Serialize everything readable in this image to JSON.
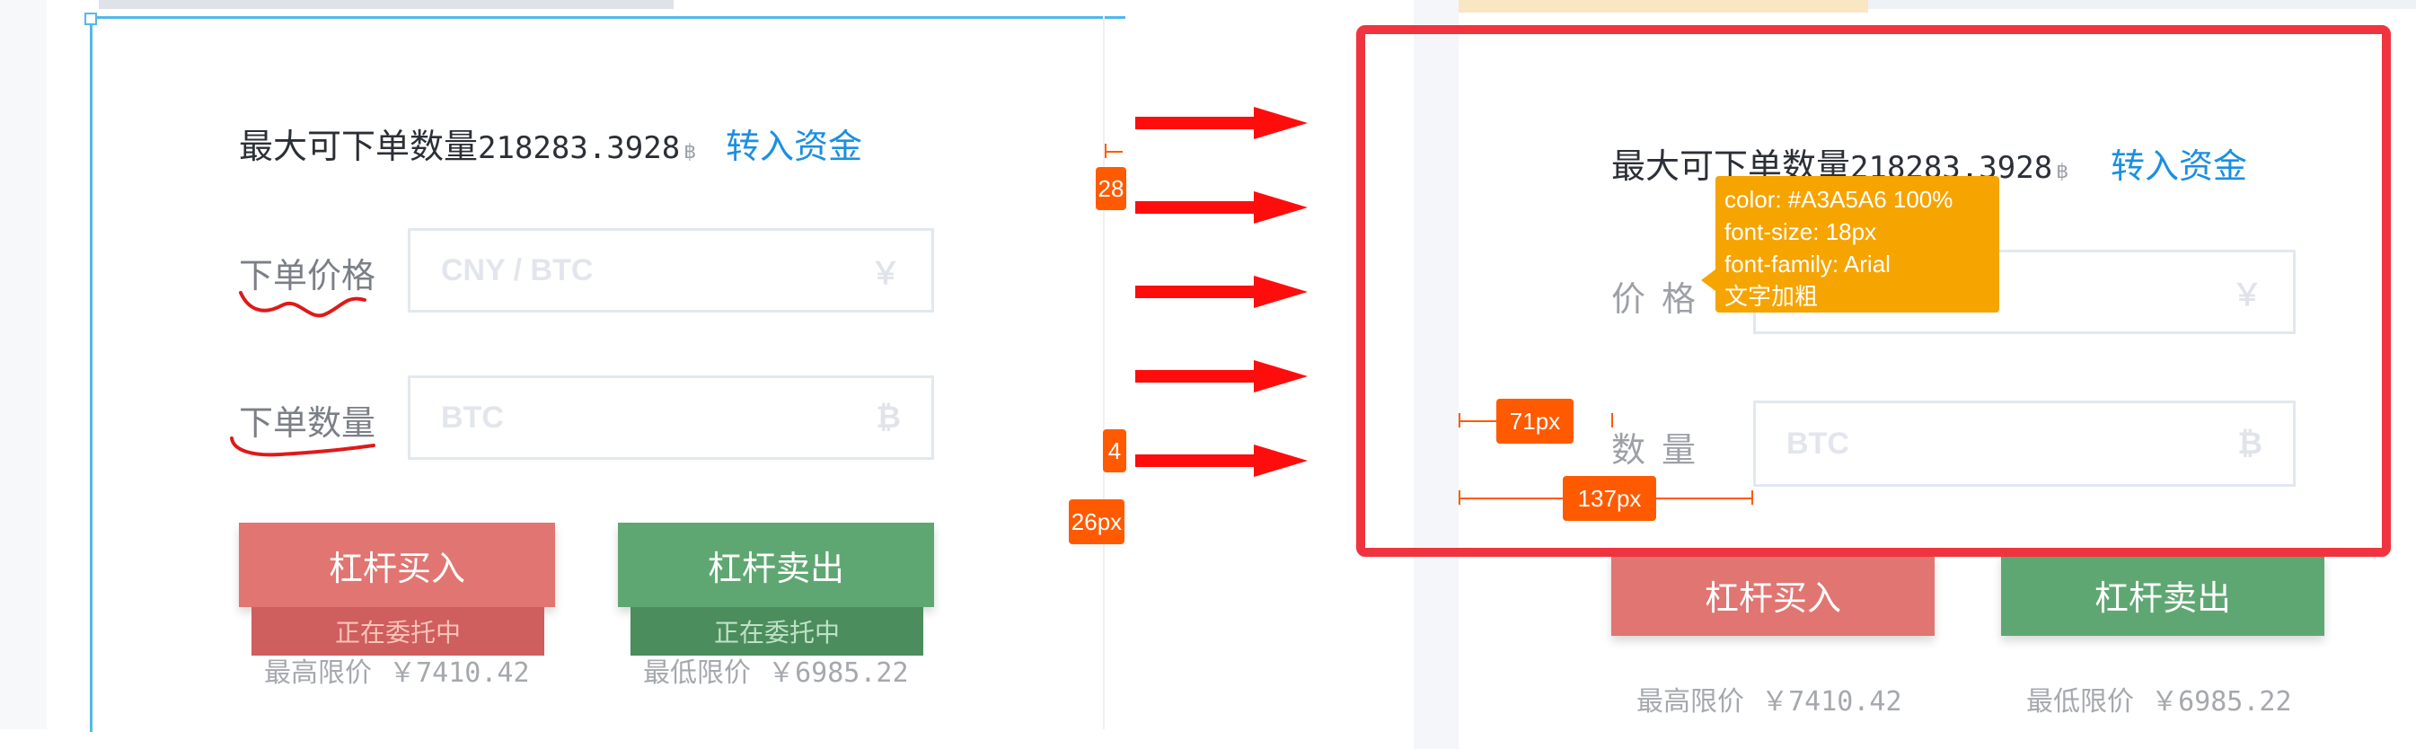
{
  "left": {
    "max_label": "最大可下单数量",
    "max_value": "218283.3928",
    "max_unit": "฿",
    "transfer_link": "转入资金",
    "price_label": "下单价格",
    "price_placeholder": "CNY / BTC",
    "price_suffix": "￥",
    "qty_label": "下单数量",
    "qty_placeholder": "BTC",
    "qty_suffix": "₿",
    "buy_label": "杠杆买入",
    "sell_label": "杠杆卖出",
    "buy_status": "正在委托中",
    "sell_status": "正在委托中",
    "high_limit_label": "最高限价",
    "high_limit_value": "￥7410.42",
    "low_limit_label": "最低限价",
    "low_limit_value": "￥6985.22",
    "tag_top": "28",
    "tag_mid": "4",
    "tag_bottom": "26px"
  },
  "right": {
    "max_label": "最大可下单数量",
    "max_value": "218283.3928",
    "max_unit": "฿",
    "transfer_link": "转入资金",
    "price_label": "价格",
    "price_suffix": "￥",
    "qty_label": "数量",
    "qty_placeholder": "BTC",
    "qty_suffix": "₿",
    "buy_label": "杠杆买入",
    "sell_label": "杠杆卖出",
    "high_limit_label": "最高限价",
    "high_limit_value": "￥7410.42",
    "low_limit_label": "最低限价",
    "low_limit_value": "￥6985.22",
    "tooltip": {
      "line1": "color: #A3A5A6 100%",
      "line2": "font-size: 18px",
      "line3": "font-family: Arial",
      "line4": "文字加粗"
    },
    "measure_71": "71px",
    "measure_137": "137px"
  },
  "colors": {
    "accent_blue": "#1b8fe0",
    "buy_red": "#e07572",
    "sell_green": "#5fa772",
    "annotation_red": "#f0343f",
    "annotation_orange": "#ff5a00",
    "tooltip_orange": "#f6a400"
  }
}
